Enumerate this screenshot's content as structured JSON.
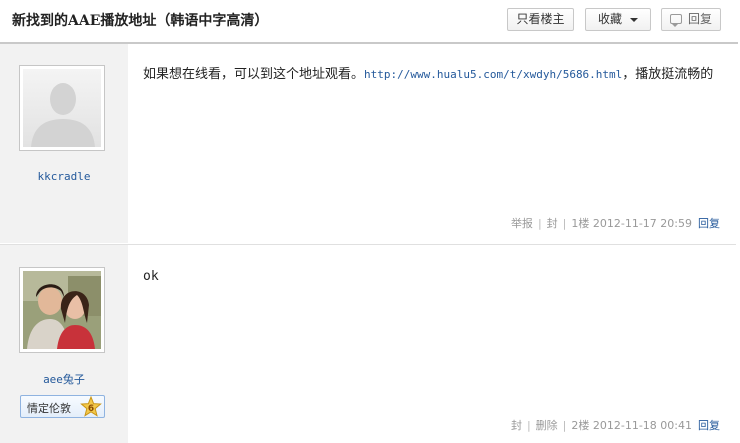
{
  "thread": {
    "title": "新找到的AAE播放地址（韩语中字高清）"
  },
  "toolbar": {
    "only_op_label": "只看楼主",
    "collect_label": "收藏",
    "reply_label": "回复"
  },
  "posts": [
    {
      "username": "kkcradle",
      "text_before": "如果想在线看，可以到这个地址观看。",
      "link": "http://www.hualu5.com/t/xwdyh/5686.html",
      "text_after": "，播放挺流畅的",
      "meta": {
        "report": "举报",
        "ban": "封",
        "floor": "1楼",
        "time": "2012-11-17 20:59",
        "reply": "回复"
      }
    },
    {
      "username": "aee兔子",
      "badge_label": "情定伦敦",
      "badge_level": "6",
      "text": "ok",
      "meta": {
        "ban": "封",
        "delete": "删除",
        "floor": "2楼",
        "time": "2012-11-18 00:41",
        "reply": "回复"
      }
    }
  ],
  "colors": {
    "link": "#24599b",
    "sidebar_bg": "#f2f2f2",
    "meta_text": "#999999"
  },
  "icons": {
    "reply_button": "speech-bubble-icon",
    "collect_dropdown": "caret-down-icon",
    "badge": "star-level-icon"
  }
}
